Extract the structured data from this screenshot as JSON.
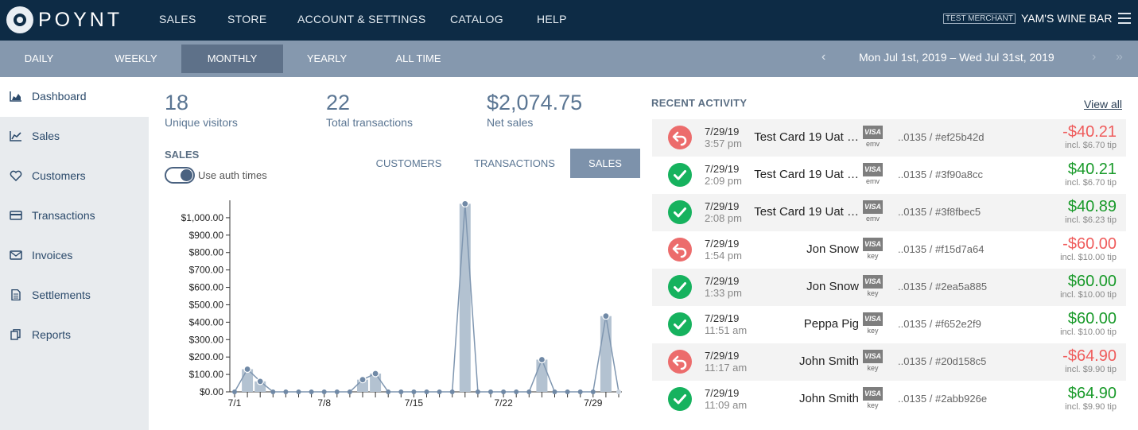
{
  "brand": {
    "name": "POYNT"
  },
  "mainnav": [
    "SALES",
    "STORE",
    "ACCOUNT & SETTINGS",
    "CATALOG",
    "HELP"
  ],
  "merchant": {
    "tag": "TEST MERCHANT",
    "name": "YAM'S WINE BAR"
  },
  "periods": [
    "DAILY",
    "WEEKLY",
    "MONTHLY",
    "YEARLY",
    "ALL TIME"
  ],
  "active_period": "MONTHLY",
  "date_range": "Mon Jul 1st, 2019 – Wed Jul 31st, 2019",
  "nav_arrows": {
    "prev": "‹",
    "next": "›",
    "last": "»"
  },
  "sidebar": {
    "items": [
      {
        "label": "Dashboard",
        "icon": "area-chart-icon"
      },
      {
        "label": "Sales",
        "icon": "line-chart-icon"
      },
      {
        "label": "Customers",
        "icon": "heart-icon"
      },
      {
        "label": "Transactions",
        "icon": "credit-card-icon"
      },
      {
        "label": "Invoices",
        "icon": "envelope-icon"
      },
      {
        "label": "Settlements",
        "icon": "document-icon"
      },
      {
        "label": "Reports",
        "icon": "copy-icon"
      }
    ]
  },
  "stats": [
    {
      "value": "18",
      "label": "Unique visitors"
    },
    {
      "value": "22",
      "label": "Total transactions"
    },
    {
      "value": "$2,074.75",
      "label": "Net sales"
    }
  ],
  "sales_section": {
    "title": "SALES",
    "toggle_label": "Use auth times"
  },
  "chart_tabs": [
    "CUSTOMERS",
    "TRANSACTIONS",
    "SALES"
  ],
  "active_chart_tab": "SALES",
  "chart_data": {
    "type": "bar",
    "title": "",
    "xlabel": "",
    "ylabel": "",
    "ylim": [
      0,
      1100
    ],
    "yticks": [
      0,
      100,
      200,
      300,
      400,
      500,
      600,
      700,
      800,
      900,
      1000
    ],
    "ytick_labels": [
      "$0.00",
      "$100.00",
      "$200.00",
      "$300.00",
      "$400.00",
      "$500.00",
      "$600.00",
      "$700.00",
      "$800.00",
      "$900.00",
      "$1,000.00"
    ],
    "xtick_labels": [
      {
        "label": "7/1",
        "day": 1
      },
      {
        "label": "7/8",
        "day": 8
      },
      {
        "label": "7/15",
        "day": 15
      },
      {
        "label": "7/22",
        "day": 22
      },
      {
        "label": "7/29",
        "day": 29
      }
    ],
    "days": [
      1,
      2,
      3,
      4,
      5,
      6,
      7,
      8,
      9,
      10,
      11,
      12,
      13,
      14,
      15,
      16,
      17,
      18,
      19,
      20,
      21,
      22,
      23,
      24,
      25,
      26,
      27,
      28,
      29,
      30,
      31
    ],
    "values": [
      0,
      130,
      60,
      0,
      0,
      0,
      0,
      0,
      0,
      0,
      70,
      105,
      0,
      0,
      0,
      0,
      0,
      0,
      1080,
      0,
      0,
      0,
      0,
      0,
      185,
      0,
      0,
      0,
      0,
      435,
      0
    ],
    "grid": false,
    "colors": {
      "bar": "#b3c2d1",
      "line": "#7f96b0",
      "point": "#7089a6"
    }
  },
  "recent_activity": {
    "title": "RECENT ACTIVITY",
    "view_all": "View all",
    "items": [
      {
        "status": "refund",
        "date": "7/29/19",
        "time": "3:57 pm",
        "name": "Test Card 19 Uat …",
        "card": "VISA",
        "mode": "emv",
        "ref": "..0135 / #ef25b42d",
        "amount": "-$40.21",
        "tip": "incl. $6.70 tip"
      },
      {
        "status": "ok",
        "date": "7/29/19",
        "time": "2:09 pm",
        "name": "Test Card 19 Uat …",
        "card": "VISA",
        "mode": "emv",
        "ref": "..0135 / #3f90a8cc",
        "amount": "$40.21",
        "tip": "incl. $6.70 tip"
      },
      {
        "status": "ok",
        "date": "7/29/19",
        "time": "2:08 pm",
        "name": "Test Card 19 Uat …",
        "card": "VISA",
        "mode": "emv",
        "ref": "..0135 / #3f8fbec5",
        "amount": "$40.89",
        "tip": "incl. $6.23 tip"
      },
      {
        "status": "refund",
        "date": "7/29/19",
        "time": "1:54 pm",
        "name": "Jon Snow",
        "card": "VISA",
        "mode": "key",
        "ref": "..0135 / #f15d7a64",
        "amount": "-$60.00",
        "tip": "incl. $10.00 tip"
      },
      {
        "status": "ok",
        "date": "7/29/19",
        "time": "1:33 pm",
        "name": "Jon Snow",
        "card": "VISA",
        "mode": "key",
        "ref": "..0135 / #2ea5a885",
        "amount": "$60.00",
        "tip": "incl. $10.00 tip"
      },
      {
        "status": "ok",
        "date": "7/29/19",
        "time": "11:51 am",
        "name": "Peppa Pig",
        "card": "VISA",
        "mode": "key",
        "ref": "..0135 / #f652e2f9",
        "amount": "$60.00",
        "tip": "incl. $10.00 tip"
      },
      {
        "status": "refund",
        "date": "7/29/19",
        "time": "11:17 am",
        "name": "John Smith",
        "card": "VISA",
        "mode": "key",
        "ref": "..0135 / #20d158c5",
        "amount": "-$64.90",
        "tip": "incl. $9.90 tip"
      },
      {
        "status": "ok",
        "date": "7/29/19",
        "time": "11:09 am",
        "name": "John Smith",
        "card": "VISA",
        "mode": "key",
        "ref": "..0135 / #2abb926e",
        "amount": "$64.90",
        "tip": "incl. $9.90 tip"
      }
    ]
  }
}
